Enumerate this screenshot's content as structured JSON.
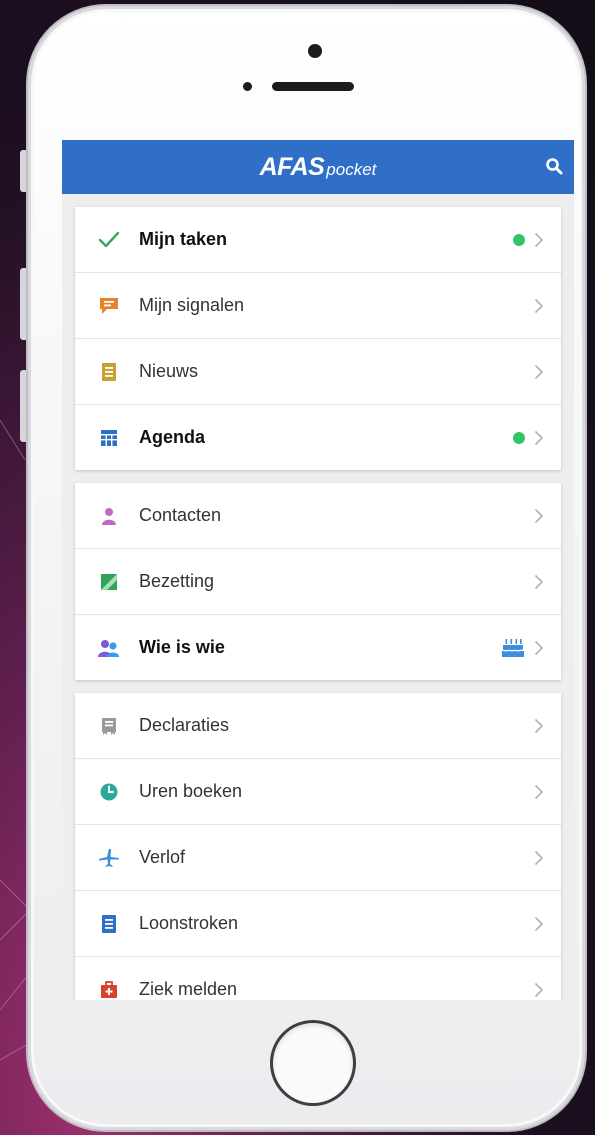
{
  "app": {
    "logo_main": "AFAS",
    "logo_sub": "pocket"
  },
  "colors": {
    "app_bar": "#2f6fc7",
    "indicator": "#34c464"
  },
  "groups": [
    [
      {
        "label": "Mijn taken",
        "icon": "check-icon",
        "bold": true,
        "indicator": "dot"
      },
      {
        "label": "Mijn signalen",
        "icon": "chat-bubble-icon",
        "bold": false,
        "indicator": ""
      },
      {
        "label": "Nieuws",
        "icon": "news-icon",
        "bold": false,
        "indicator": ""
      },
      {
        "label": "Agenda",
        "icon": "calendar-icon",
        "bold": true,
        "indicator": "dot"
      }
    ],
    [
      {
        "label": "Contacten",
        "icon": "person-icon",
        "bold": false,
        "indicator": ""
      },
      {
        "label": "Bezetting",
        "icon": "occupancy-icon",
        "bold": false,
        "indicator": ""
      },
      {
        "label": "Wie is wie",
        "icon": "people-icon",
        "bold": true,
        "indicator": "birthday-cake-icon"
      }
    ],
    [
      {
        "label": "Declaraties",
        "icon": "receipt-icon",
        "bold": false,
        "indicator": ""
      },
      {
        "label": "Uren boeken",
        "icon": "clock-icon",
        "bold": false,
        "indicator": ""
      },
      {
        "label": "Verlof",
        "icon": "airplane-icon",
        "bold": false,
        "indicator": ""
      },
      {
        "label": "Loonstroken",
        "icon": "payslip-icon",
        "bold": false,
        "indicator": ""
      },
      {
        "label": "Ziek melden",
        "icon": "first-aid-icon",
        "bold": false,
        "indicator": ""
      }
    ]
  ]
}
